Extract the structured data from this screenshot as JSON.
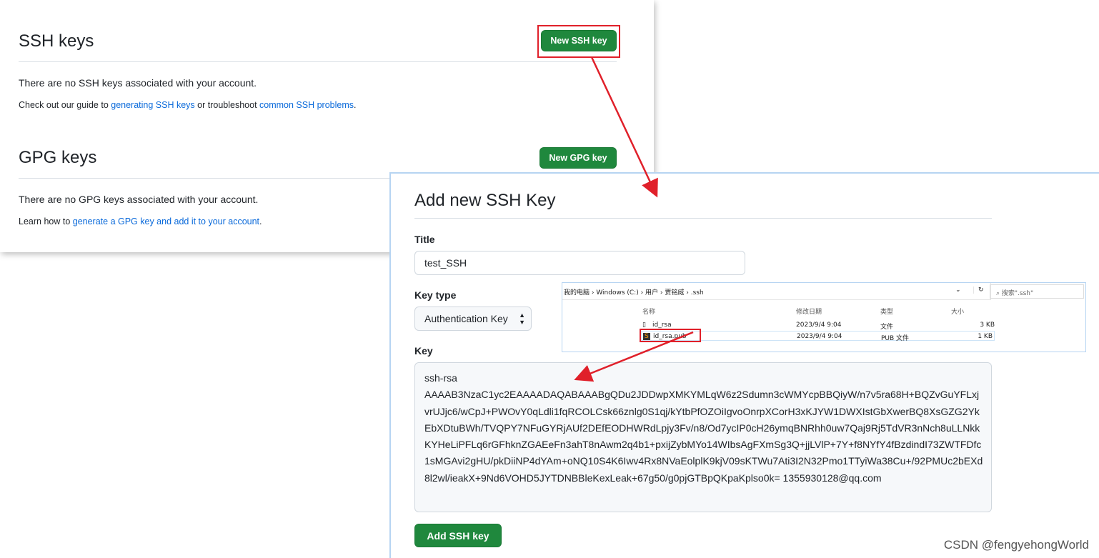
{
  "ssh": {
    "title": "SSH keys",
    "button": "New SSH key",
    "empty": "There are no SSH keys associated with your account.",
    "guide_prefix": "Check out our guide to ",
    "guide_link1": "generating SSH keys",
    "guide_mid": " or troubleshoot ",
    "guide_link2": "common SSH problems",
    "guide_suffix": "."
  },
  "gpg": {
    "title": "GPG keys",
    "button": "New GPG key",
    "empty": "There are no GPG keys associated with your account.",
    "learn_prefix": "Learn how to ",
    "learn_link": "generate a GPG key and add it to your account",
    "learn_suffix": "."
  },
  "dialog": {
    "title": "Add new SSH Key",
    "title_label": "Title",
    "title_value": "test_SSH",
    "key_type_label": "Key type",
    "key_type_value": "Authentication Key",
    "key_label": "Key",
    "key_value": "ssh-rsa\nAAAAB3NzaC1yc2EAAAADAQABAAABgQDu2JDDwpXMKYMLqW6z2Sdumn3cWMYcpBBQiyW/n7v5ra68H+BQZvGuYFLxjvrUJjc6/wCpJ+PWOvY0qLdli1fqRCOLCsk66znlg0S1qj/kYtbPfOZOiIgvoOnrpXCorH3xKJYW1DWXIstGbXwerBQ8XsGZG2YkEbXDtuBWh/TVQPY7NFuGYRjAUf2DEfEODHWRdLpjy3Fv/n8/Od7ycIP0cH26ymqBNRhh0uw7Qaj9Rj5TdVR3nNch8uLLNkkKYHeLiPFLq6rGFhknZGAEeFn3ahT8nAwm2q4b1+pxijZybMYo14WIbsAgFXmSg3Q+jjLVlP+7Y+f8NYfY4fBzdindI73ZWTFDfc1sMGAvi2gHU/pkDiiNP4dYAm+oNQ10S4K6Iwv4Rx8NVaEolplK9kjV09sKTWu7Ati3I2N32Pmo1TTyiWa38Cu+/92PMUc2bEXd8l2wl/ieakX+9Nd6VOHD5JYTDNBBleKexLeak+67g50/g0pjGTBpQKpaKplso0k= 1355930128@qq.com",
    "submit": "Add SSH key"
  },
  "explorer": {
    "breadcrumb": [
      "我的电脑",
      "Windows (C:)",
      "用户",
      "贾铭威",
      ".ssh"
    ],
    "search_placeholder": "搜索\".ssh\"",
    "columns": [
      "名称",
      "修改日期",
      "类型",
      "大小"
    ],
    "files": [
      {
        "name": "id_rsa",
        "date": "2023/9/4 9:04",
        "type": "文件",
        "size": "3 KB"
      },
      {
        "name": "id_rsa.pub",
        "date": "2023/9/4 9:04",
        "type": "PUB 文件",
        "size": "1 KB"
      }
    ]
  },
  "watermark": "CSDN @fengyehongWorld",
  "colors": {
    "accent": "#1f883d",
    "link": "#0969da",
    "annotation": "#e0202a"
  }
}
